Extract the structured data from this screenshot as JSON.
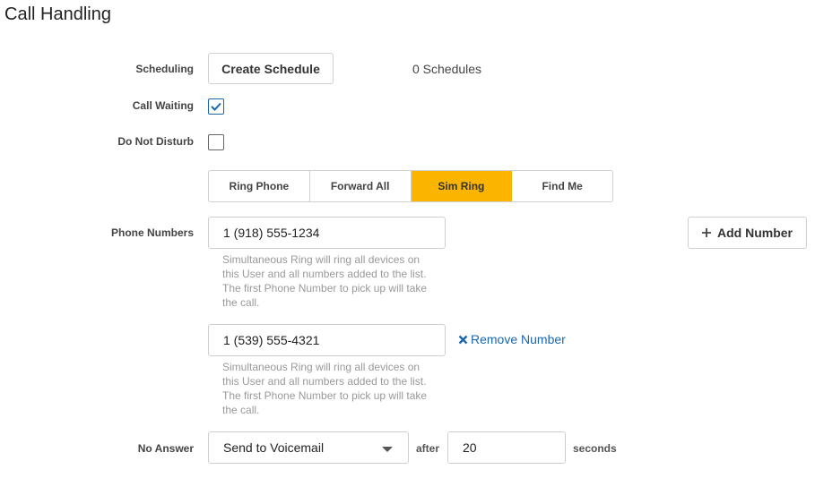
{
  "page": {
    "title": "Call Handling"
  },
  "scheduling": {
    "label": "Scheduling",
    "button": "Create Schedule",
    "count": "0 Schedules"
  },
  "call_waiting": {
    "label": "Call Waiting",
    "checked": true
  },
  "do_not_disturb": {
    "label": "Do Not Disturb",
    "checked": false
  },
  "modes": {
    "items": [
      "Ring Phone",
      "Forward All",
      "Sim Ring",
      "Find Me"
    ],
    "active": "Sim Ring",
    "active_color": "#fbb500"
  },
  "phone_numbers": {
    "label": "Phone Numbers",
    "add_button": "Add Number",
    "entries": [
      {
        "value": "1 (918) 555-1234",
        "help": "Simultaneous Ring will ring all devices on this User and all numbers added to the list. The first Phone Number to pick up will take the call."
      },
      {
        "value": "1 (539) 555-4321",
        "help": "Simultaneous Ring will ring all devices on this User and all numbers added to the list. The first Phone Number to pick up will take the call.",
        "remove_label": "Remove Number"
      }
    ]
  },
  "no_answer": {
    "label": "No Answer",
    "selected": "Send to Voicemail",
    "after_label": "after",
    "seconds_value": "20",
    "seconds_label": "seconds"
  },
  "colors": {
    "link": "#1a66b0",
    "accent": "#fbb500"
  },
  "icons": {
    "plus": "plus-icon",
    "remove": "close-icon",
    "check": "check-icon",
    "caret": "chevron-down-icon"
  }
}
